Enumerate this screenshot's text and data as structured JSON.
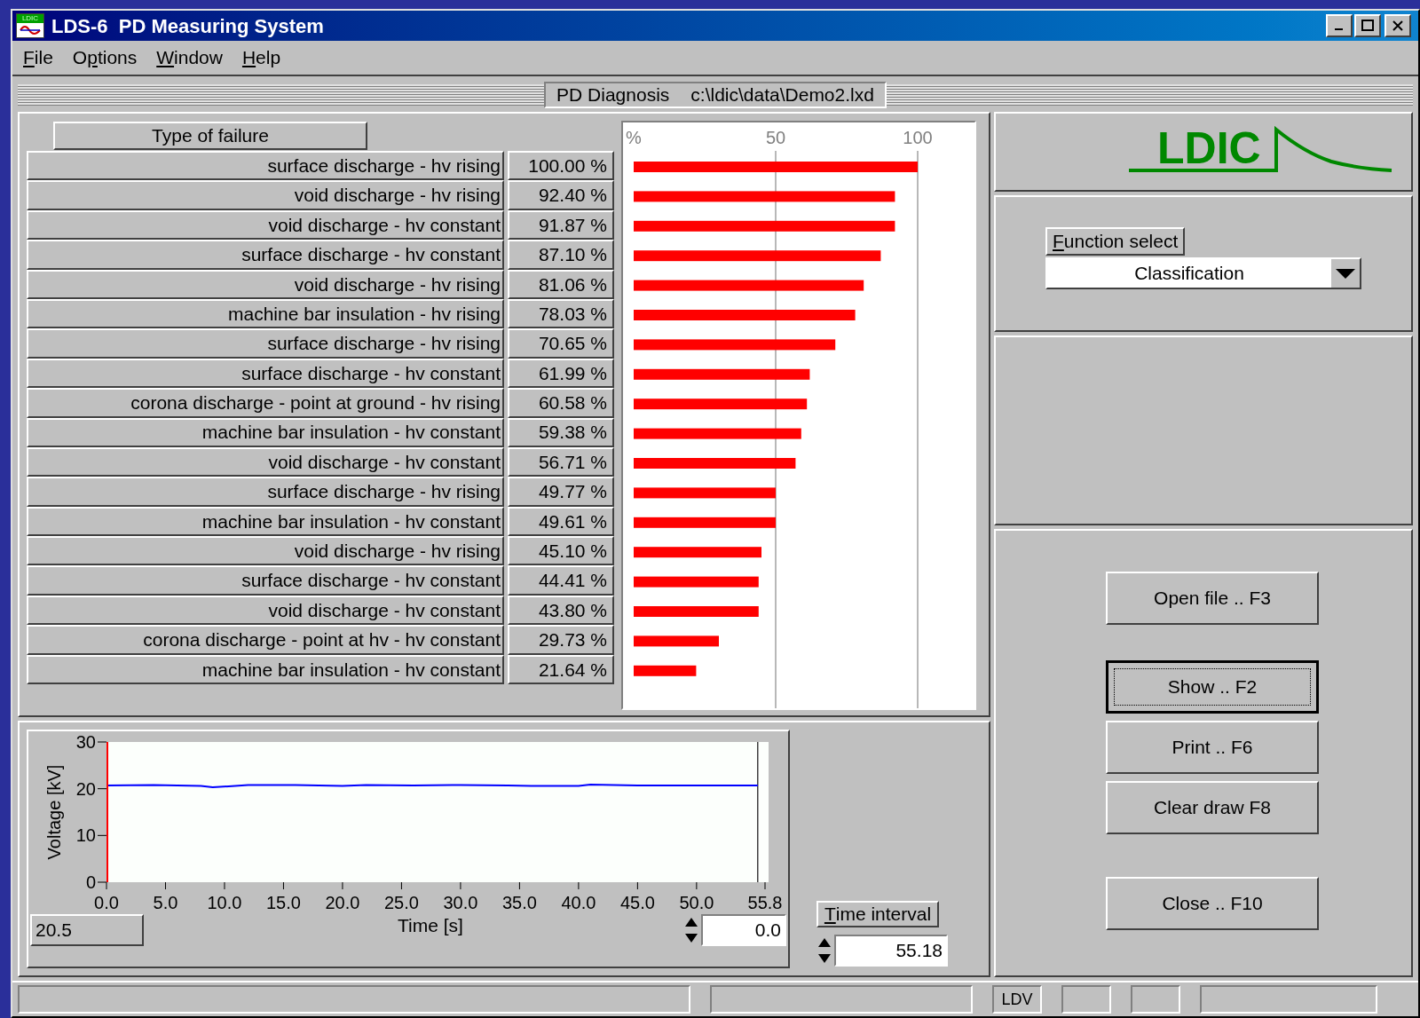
{
  "window": {
    "title": "LDS-6  PD Measuring System",
    "icon_label": "LDIC"
  },
  "menu": [
    {
      "label": "File"
    },
    {
      "label": "Options"
    },
    {
      "label": "Window"
    },
    {
      "label": "Help"
    }
  ],
  "caption": {
    "mode": "PD Diagnosis",
    "path": "c:\\ldic\\data\\Demo2.lxd"
  },
  "failures": {
    "header": "Type of failure",
    "rows": [
      {
        "label": "surface discharge - hv rising",
        "percent": "100.00 %"
      },
      {
        "label": "void discharge - hv rising",
        "percent": "92.40 %"
      },
      {
        "label": "void discharge - hv constant",
        "percent": "91.87 %"
      },
      {
        "label": "surface discharge - hv constant",
        "percent": "87.10 %"
      },
      {
        "label": "void discharge - hv rising",
        "percent": "81.06 %"
      },
      {
        "label": "machine bar insulation - hv rising",
        "percent": "78.03 %"
      },
      {
        "label": "surface discharge - hv rising",
        "percent": "70.65 %"
      },
      {
        "label": "surface discharge - hv constant",
        "percent": "61.99 %"
      },
      {
        "label": "corona discharge - point at ground - hv rising",
        "percent": "60.58 %"
      },
      {
        "label": "machine bar insulation - hv constant",
        "percent": "59.38 %"
      },
      {
        "label": "void discharge - hv constant",
        "percent": "56.71 %"
      },
      {
        "label": "surface discharge - hv rising",
        "percent": "49.77 %"
      },
      {
        "label": "machine bar insulation - hv constant",
        "percent": "49.61 %"
      },
      {
        "label": "void discharge - hv rising",
        "percent": "45.10 %"
      },
      {
        "label": "surface discharge - hv constant",
        "percent": "44.41 %"
      },
      {
        "label": "void discharge - hv constant",
        "percent": "43.80 %"
      },
      {
        "label": "corona discharge - point at hv - hv constant",
        "percent": "29.73 %"
      },
      {
        "label": "machine bar insulation - hv constant",
        "percent": "21.64 %"
      }
    ],
    "chart_data": {
      "type": "bar",
      "orientation": "horizontal",
      "xlim": [
        0,
        120
      ],
      "xticks": [
        {
          "value": 0,
          "label": "%"
        },
        {
          "value": 50,
          "label": "50"
        },
        {
          "value": 100,
          "label": "100"
        }
      ],
      "series": [
        {
          "color": "#ff0000",
          "values": [
            100,
            92,
            92,
            87,
            81,
            78,
            71,
            62,
            61,
            59,
            57,
            50,
            50,
            45,
            44,
            44,
            30,
            22
          ]
        }
      ]
    }
  },
  "logo": {
    "text": "LDIC"
  },
  "function_select": {
    "label": "Function select",
    "value": "Classification"
  },
  "buttons": [
    {
      "label": "Open file .. F3",
      "focused": false
    },
    {
      "label": "Show .. F2",
      "focused": true
    },
    {
      "label": "Print .. F6",
      "focused": false
    },
    {
      "label": "Clear draw  F8",
      "focused": false
    },
    {
      "label": "Close .. F10",
      "focused": false
    }
  ],
  "voltage": {
    "chart_data": {
      "type": "line",
      "xlabel": "Time [s]",
      "ylabel": "Voltage [kV]",
      "xlim": [
        0,
        55.8
      ],
      "ylim": [
        0,
        30
      ],
      "xticks": [
        {
          "value": 0,
          "label": "0.0"
        },
        {
          "value": 5,
          "label": "5.0"
        },
        {
          "value": 10,
          "label": "10.0"
        },
        {
          "value": 15,
          "label": "15.0"
        },
        {
          "value": 20,
          "label": "20.0"
        },
        {
          "value": 25,
          "label": "25.0"
        },
        {
          "value": 30,
          "label": "30.0"
        },
        {
          "value": 35,
          "label": "35.0"
        },
        {
          "value": 40,
          "label": "40.0"
        },
        {
          "value": 45,
          "label": "45.0"
        },
        {
          "value": 50,
          "label": "50.0"
        },
        {
          "value": 55.8,
          "label": "55.8"
        }
      ],
      "yticks": [
        {
          "value": 0,
          "label": "0"
        },
        {
          "value": 10,
          "label": "10"
        },
        {
          "value": 20,
          "label": "20"
        },
        {
          "value": 30,
          "label": "30"
        }
      ],
      "ref_lines": [
        {
          "value": 55.18,
          "axis": "x"
        }
      ],
      "x": [
        0,
        4,
        8,
        9,
        12,
        16,
        20,
        22,
        26,
        30,
        34,
        36,
        40,
        41,
        45,
        50,
        55.18
      ],
      "series": [
        {
          "color": "#0000ff",
          "values": [
            20.7,
            20.8,
            20.6,
            20.3,
            20.8,
            20.8,
            20.6,
            20.8,
            20.7,
            20.8,
            20.7,
            20.6,
            20.6,
            20.9,
            20.7,
            20.7,
            20.7
          ]
        }
      ]
    },
    "cursor_reading": "20.5",
    "start": "0.0",
    "interval_label": "Time interval",
    "interval": "55.18"
  },
  "status_bar": {
    "label": "LDV"
  }
}
